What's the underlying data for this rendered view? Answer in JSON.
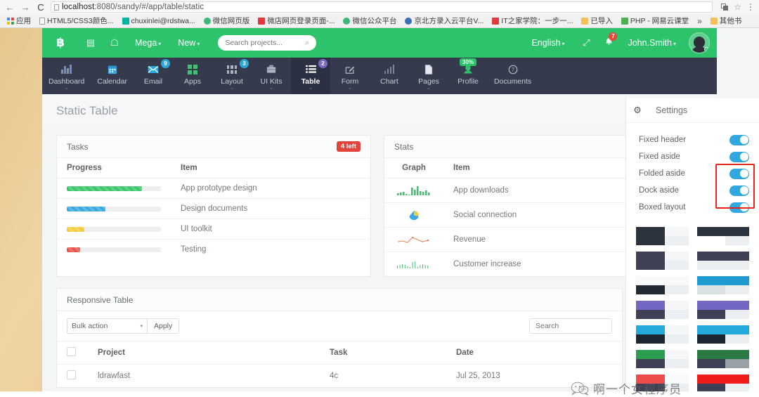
{
  "browser": {
    "back_icon": "←",
    "forward_icon": "→",
    "reload_icon": "C",
    "url_prefix": "localhost",
    "url_suffix": ":8080/sandy/#/app/table/static",
    "full_url": "localhost:8080/sandy/#/app/table/static",
    "star_icon": "☆",
    "menu_icon": "⋮",
    "bookmarks": [
      {
        "label": "应用",
        "icon": "grid"
      },
      {
        "label": "HTML5/CSS3颜色...",
        "icon": "doc"
      },
      {
        "label": "chuxinlei@rdstwa...",
        "icon": "teal"
      },
      {
        "label": "微信网页版",
        "icon": "green"
      },
      {
        "label": "微店网页登录页面-...",
        "icon": "red"
      },
      {
        "label": "微信公众平台",
        "icon": "green"
      },
      {
        "label": "京北方录入云平台V...",
        "icon": "blue"
      },
      {
        "label": "IT之家学院：一步一...",
        "icon": "redsq"
      },
      {
        "label": "已导入",
        "icon": "folder"
      },
      {
        "label": "PHP - 网易云课堂",
        "icon": "greensq"
      }
    ],
    "overflow_label": "»",
    "other_bookmarks": "其他书"
  },
  "header": {
    "logo": "฿",
    "icon_card": "▤",
    "icon_user": "☖",
    "menus": [
      {
        "label": "Mega",
        "caret": "▾"
      },
      {
        "label": "New",
        "caret": "▾"
      }
    ],
    "search_placeholder": "Search projects...",
    "search_value": "",
    "search_icon": "⌕",
    "language": "English",
    "language_caret": "▾",
    "expand_icon": "⤢",
    "bell_icon": "🔔",
    "bell_count": "7",
    "user": "John.Smith",
    "user_caret": "▾"
  },
  "nav": {
    "items": [
      {
        "label": "Dashboard",
        "icon": "chart-bars",
        "badge": "",
        "badge_color": "",
        "caret": "⌄",
        "active": false
      },
      {
        "label": "Calendar",
        "icon": "calendar",
        "badge": "",
        "badge_color": "",
        "caret": "",
        "active": false
      },
      {
        "label": "Email",
        "icon": "envelope",
        "badge": "9",
        "badge_color": "blue",
        "caret": "",
        "active": false
      },
      {
        "label": "Apps",
        "icon": "squares-green",
        "badge": "",
        "badge_color": "",
        "caret": "",
        "active": false
      },
      {
        "label": "Layout",
        "icon": "grid-nine",
        "badge": "3",
        "badge_color": "blue",
        "caret": "⌄",
        "active": false
      },
      {
        "label": "UI Kits",
        "icon": "briefcase",
        "badge": "",
        "badge_color": "",
        "caret": "⌄",
        "active": false
      },
      {
        "label": "Table",
        "icon": "list",
        "badge": "2",
        "badge_color": "purple",
        "caret": "⌄",
        "active": true
      },
      {
        "label": "Form",
        "icon": "pencil-square",
        "badge": "",
        "badge_color": "",
        "caret": "⌄",
        "active": false
      },
      {
        "label": "Chart",
        "icon": "bar-chart",
        "badge": "",
        "badge_color": "",
        "caret": "",
        "active": false
      },
      {
        "label": "Pages",
        "icon": "file",
        "badge": "",
        "badge_color": "",
        "caret": "⌄",
        "active": false
      },
      {
        "label": "Profile",
        "icon": "user-pin",
        "badge": "30%",
        "badge_color": "bubble",
        "caret": "",
        "active": false
      },
      {
        "label": "Documents",
        "icon": "question-circle",
        "badge": "",
        "badge_color": "",
        "caret": "",
        "active": false
      }
    ]
  },
  "page": {
    "title": "Static Table"
  },
  "tasks_card": {
    "title": "Tasks",
    "badge": "4 left",
    "columns": [
      "Progress",
      "Item"
    ],
    "rows": [
      {
        "item": "App prototype design",
        "percent": 80,
        "color": "#3cc76a"
      },
      {
        "item": "Design documents",
        "percent": 41,
        "color": "#3aa9e0"
      },
      {
        "item": "UI toolkit",
        "percent": 19,
        "color": "#f5cc3e"
      },
      {
        "item": "Testing",
        "percent": 14,
        "color": "#e8544a"
      }
    ]
  },
  "stats_card": {
    "title": "Stats",
    "columns": [
      "Graph",
      "Item"
    ],
    "rows": [
      {
        "item": "App downloads",
        "graph": "bar-sparkline",
        "color": "#3cc76a"
      },
      {
        "item": "Social connection",
        "graph": "pie-sparkline",
        "color": "#3aa9e0"
      },
      {
        "item": "Revenue",
        "graph": "line-sparkline",
        "color": "#e8845a"
      },
      {
        "item": "Customer increase",
        "graph": "discrete-sparkline",
        "color": "#3cc76a"
      }
    ]
  },
  "responsive_card": {
    "title": "Responsive Table",
    "bulk_action_label": "Bulk action",
    "bulk_action_caret": "▾",
    "apply_label": "Apply",
    "search_placeholder": "Search",
    "search_value": "",
    "columns": [
      "",
      "Project",
      "Task",
      "Date"
    ],
    "rows": [
      {
        "project": "ldrawfast",
        "task": "4c",
        "date": "Jul 25, 2013"
      }
    ]
  },
  "settings_panel": {
    "gear_icon": "⚙",
    "title": "Settings",
    "options": [
      {
        "label": "Fixed header",
        "on": true
      },
      {
        "label": "Fixed aside",
        "on": true
      },
      {
        "label": "Folded aside",
        "on": true
      },
      {
        "label": "Dock aside",
        "on": true
      },
      {
        "label": "Boxed layout",
        "on": true
      }
    ],
    "highlight_color": "#e8231c",
    "toggle_on_color": "#2fa8e0",
    "swatches": [
      {
        "top_left": "#2c333d",
        "top_right": "#f4f6f7",
        "bot_left": "#2c333d",
        "bot_right": "#eceff1",
        "style": "left"
      },
      {
        "top_left": "#2c333d",
        "top_right": "#2c333d",
        "bot_left": "#ffffff",
        "bot_right": "#eceff1",
        "style": "full"
      },
      {
        "top_left": "#3e4155",
        "top_right": "#f4f6f7",
        "bot_left": "#3e4155",
        "bot_right": "#eceff1",
        "style": "left"
      },
      {
        "top_left": "#3e4155",
        "top_right": "#3e4155",
        "bot_left": "#eceff1",
        "bot_right": "#eceff1",
        "style": "full"
      },
      {
        "top_left": "#f7f9fa",
        "top_right": "#f7f9fa",
        "bot_left": "#222b33",
        "bot_right": "#eceff1",
        "style": "left"
      },
      {
        "top_left": "#1f9bd1",
        "top_right": "#1f9bd1",
        "bot_left": "#dbe2e6",
        "bot_right": "#eceff1",
        "style": "full"
      },
      {
        "top_left": "#7267c2",
        "top_right": "#f4f6f7",
        "bot_left": "#3e4155",
        "bot_right": "#eceff1",
        "style": "left"
      },
      {
        "top_left": "#7267c2",
        "top_right": "#7267c2",
        "bot_left": "#3e4155",
        "bot_right": "#eceff1",
        "style": "full"
      },
      {
        "top_left": "#24aada",
        "top_right": "#f4f6f7",
        "bot_left": "#1b2733",
        "bot_right": "#eceff1",
        "style": "left"
      },
      {
        "top_left": "#24aada",
        "top_right": "#24aada",
        "bot_left": "#1b2733",
        "bot_right": "#eceff1",
        "style": "full"
      },
      {
        "top_left": "#2b9e4f",
        "top_right": "#f4f6f7",
        "bot_left": "#3e4155",
        "bot_right": "#eceff1",
        "style": "left"
      },
      {
        "top_left": "#2b7a45",
        "top_right": "#2b7a45",
        "bot_left": "#3e4155",
        "bot_right": "#9aa1a6",
        "style": "full"
      },
      {
        "top_left": "#ef4c4c",
        "top_right": "#f7f9fa",
        "bot_left": "#3e4155",
        "bot_right": "#eceff1",
        "style": "left"
      },
      {
        "top_left": "#f01b1b",
        "top_right": "#f01b1b",
        "bot_left": "#3e4155",
        "bot_right": "#eceff1",
        "style": "full"
      }
    ]
  },
  "watermark": {
    "text": "啊一个女程序员",
    "logo": "wechat-logo"
  }
}
